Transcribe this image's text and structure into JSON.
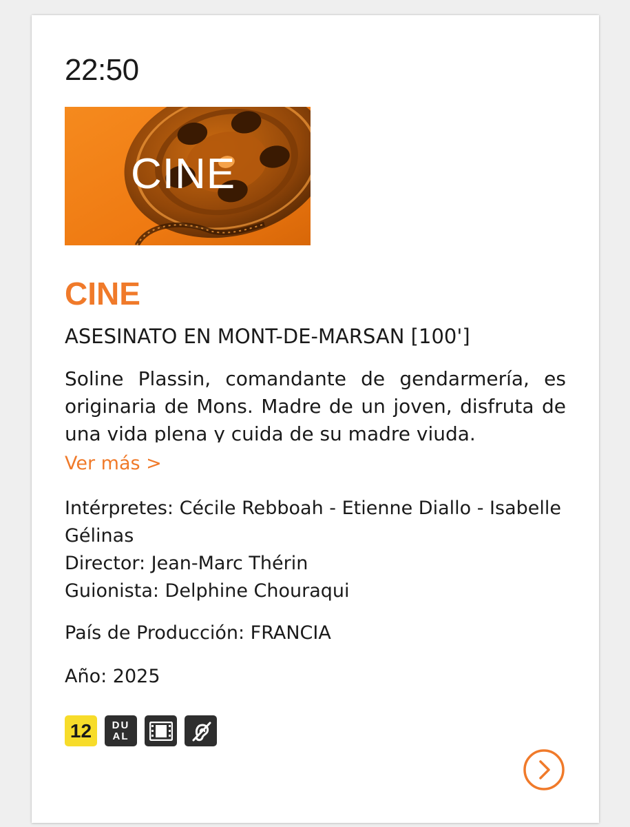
{
  "program": {
    "time": "22:50",
    "banner_text": "CINE",
    "category": "CINE",
    "title": "ASESINATO EN MONT-DE-MARSAN [100']",
    "synopsis": "Soline Plassin, comandante de gendarmería, es originaria de Mons. Madre de un joven, disfruta de una vida plena y cuida de su madre viuda.",
    "more_link": "Ver más >",
    "cast": "Intérpretes: Cécile Rebboah - Etienne Diallo - Isabelle Gélinas",
    "director": "Director: Jean-Marc Thérin",
    "writer": "Guionista: Delphine Chouraqui",
    "country": "País de Producción: FRANCIA",
    "year": "Año: 2025"
  },
  "badges": {
    "age": "12",
    "dual_top": "DU",
    "dual_bottom": "AL",
    "subtitles_icon": "film-icon",
    "accessibility_icon": "hearing-impaired-icon"
  },
  "colors": {
    "accent": "#f07a2a",
    "age_badge": "#f7dc2a",
    "badge_dark": "#2e2e2e"
  },
  "icons": {
    "next": "chevron-right-circle-icon"
  }
}
